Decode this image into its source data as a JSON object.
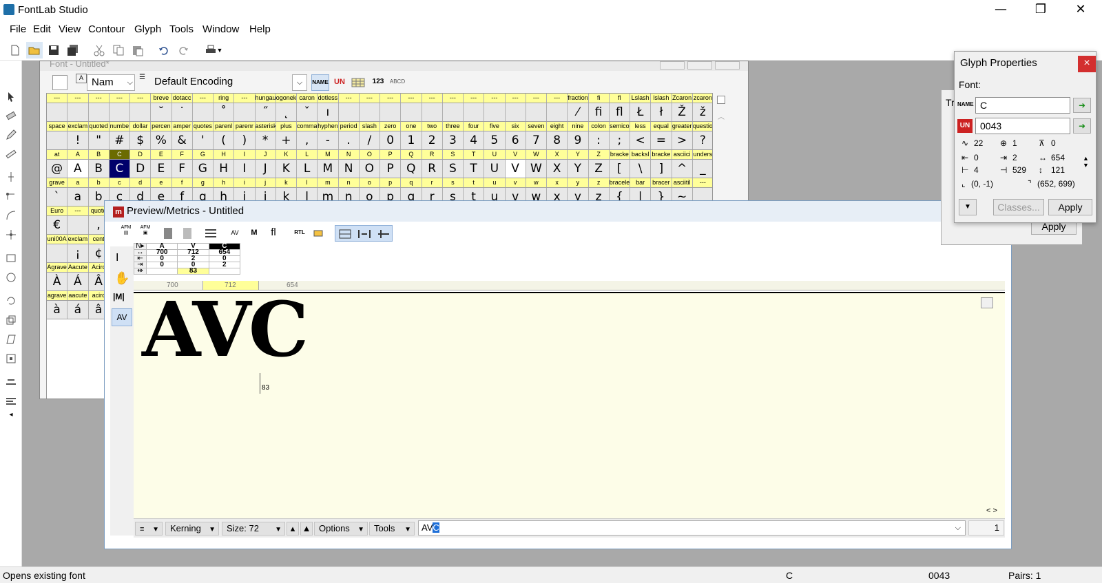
{
  "app": {
    "title": "FontLab Studio",
    "minimize": "—",
    "restore": "❐",
    "close": "✕"
  },
  "menu": [
    "File",
    "Edit",
    "View",
    "Contour",
    "Glyph",
    "Tools",
    "Window",
    "Help"
  ],
  "font_window": {
    "title": "Font - Untitled*",
    "mode_label": "Nam",
    "encoding": "Default Encoding",
    "rows": [
      {
        "labels": [
          "---",
          "---",
          "---",
          "---",
          "---",
          "breve",
          "dotacc",
          "---",
          "ring",
          "---",
          "hungau",
          "ogonek",
          "caron",
          "dotless",
          "---",
          "---",
          "---",
          "---",
          "---",
          "---",
          "---",
          "---",
          "---",
          "---",
          "---",
          "fraction",
          "fi",
          "fl",
          "Lslash",
          "lslash",
          "Zcaron",
          "zcaron"
        ],
        "chars": [
          "",
          "",
          "",
          "",
          "",
          "˘",
          "˙",
          "",
          "˚",
          "",
          "˝",
          "˛",
          "ˇ",
          "ı",
          "",
          "",
          "",
          "",
          "",
          "",
          "",
          "",
          "",
          "",
          "",
          "⁄",
          "ﬁ",
          "ﬂ",
          "Ł",
          "ł",
          "Ž",
          "ž"
        ]
      },
      {
        "labels": [
          "space",
          "exclam",
          "quoted",
          "numbe",
          "dollar",
          "percen",
          "amper",
          "quotes",
          "parenl",
          "parenr",
          "asterisk",
          "plus",
          "comma",
          "hyphen",
          "period",
          "slash",
          "zero",
          "one",
          "two",
          "three",
          "four",
          "five",
          "six",
          "seven",
          "eight",
          "nine",
          "colon",
          "semico",
          "less",
          "equal",
          "greater",
          "questio"
        ],
        "chars": [
          "",
          "!",
          "\"",
          "#",
          "$",
          "%",
          "&",
          "'",
          "(",
          ")",
          "*",
          "+",
          ",",
          "-",
          ".",
          "/",
          "0",
          "1",
          "2",
          "3",
          "4",
          "5",
          "6",
          "7",
          "8",
          "9",
          ":",
          ";",
          "<",
          "=",
          ">",
          "?"
        ]
      },
      {
        "labels": [
          "at",
          "A",
          "B",
          "C",
          "D",
          "E",
          "F",
          "G",
          "H",
          "I",
          "J",
          "K",
          "L",
          "M",
          "N",
          "O",
          "P",
          "Q",
          "R",
          "S",
          "T",
          "U",
          "V",
          "W",
          "X",
          "Y",
          "Z",
          "bracke",
          "backsl",
          "bracke",
          "asciici",
          "unders"
        ],
        "chars": [
          "@",
          "A",
          "B",
          "C",
          "D",
          "E",
          "F",
          "G",
          "H",
          "I",
          "J",
          "K",
          "L",
          "M",
          "N",
          "O",
          "P",
          "Q",
          "R",
          "S",
          "T",
          "U",
          "V",
          "W",
          "X",
          "Y",
          "Z",
          "[",
          "\\",
          "]",
          "^",
          "_"
        ]
      },
      {
        "labels": [
          "grave",
          "a",
          "b",
          "c",
          "d",
          "e",
          "f",
          "g",
          "h",
          "i",
          "j",
          "k",
          "l",
          "m",
          "n",
          "o",
          "p",
          "q",
          "r",
          "s",
          "t",
          "u",
          "v",
          "w",
          "x",
          "y",
          "z",
          "bracele",
          "bar",
          "bracer",
          "asciitil",
          "---"
        ],
        "chars": [
          "`",
          "a",
          "b",
          "c",
          "d",
          "e",
          "f",
          "g",
          "h",
          "i",
          "j",
          "k",
          "l",
          "m",
          "n",
          "o",
          "p",
          "q",
          "r",
          "s",
          "t",
          "u",
          "v",
          "w",
          "x",
          "y",
          "z",
          "{",
          "|",
          "}",
          "~",
          ""
        ]
      },
      {
        "labels": [
          "Euro",
          "---",
          "quote"
        ],
        "chars": [
          "€",
          "",
          ","
        ]
      },
      {
        "labels": [
          "uni00A",
          "exclam",
          "cent"
        ],
        "chars": [
          "",
          "¡",
          "¢"
        ]
      },
      {
        "labels": [
          "Agrave",
          "Aacute",
          "Acirc"
        ],
        "chars": [
          "À",
          "Á",
          "Â"
        ]
      },
      {
        "labels": [
          "agrave",
          "aacute",
          "acirc"
        ],
        "chars": [
          "à",
          "á",
          "â"
        ]
      }
    ]
  },
  "preview_window": {
    "title": "Preview/Metrics - Untitled",
    "metrics": {
      "glyphs": [
        "A",
        "V",
        "C"
      ],
      "widths": [
        "700",
        "712",
        "654"
      ],
      "lsb": [
        "0",
        "2",
        "0"
      ],
      "rsb": [
        "0",
        "0",
        "2"
      ],
      "kern": [
        "",
        "83",
        ""
      ]
    },
    "ruler": [
      "700",
      "712",
      "654"
    ],
    "sample_text": "AVC",
    "kern_marker": "83",
    "bottom": {
      "mode": "Kerning",
      "size": "Size: 72",
      "options": "Options",
      "tools": "Tools",
      "text_plain": "AV",
      "text_selected": "C",
      "count": "1"
    }
  },
  "glyph_properties": {
    "title": "Glyph Properties",
    "font_label": "Font:",
    "name_value": "C",
    "unicode_value": "0043",
    "stats": {
      "r1": [
        "22",
        "1",
        "0"
      ],
      "r2": [
        "0",
        "2",
        "654"
      ],
      "r3": [
        "4",
        "529",
        "121"
      ],
      "bbox_min": "(0, -1)",
      "bbox_max": "(652, 699)"
    },
    "classes_label": "Classes...",
    "apply_label": "Apply",
    "apply_label_2": "Apply",
    "partial_title": "Tr"
  },
  "status": {
    "message": "Opens existing font",
    "glyph": "C",
    "unicode": "0043",
    "pairs": "Pairs: 1"
  },
  "colors": {
    "selected_cell": "#00006b",
    "label_row": "#ffff99",
    "canvas": "#fdfde8",
    "close_red": "#d32f2f"
  }
}
